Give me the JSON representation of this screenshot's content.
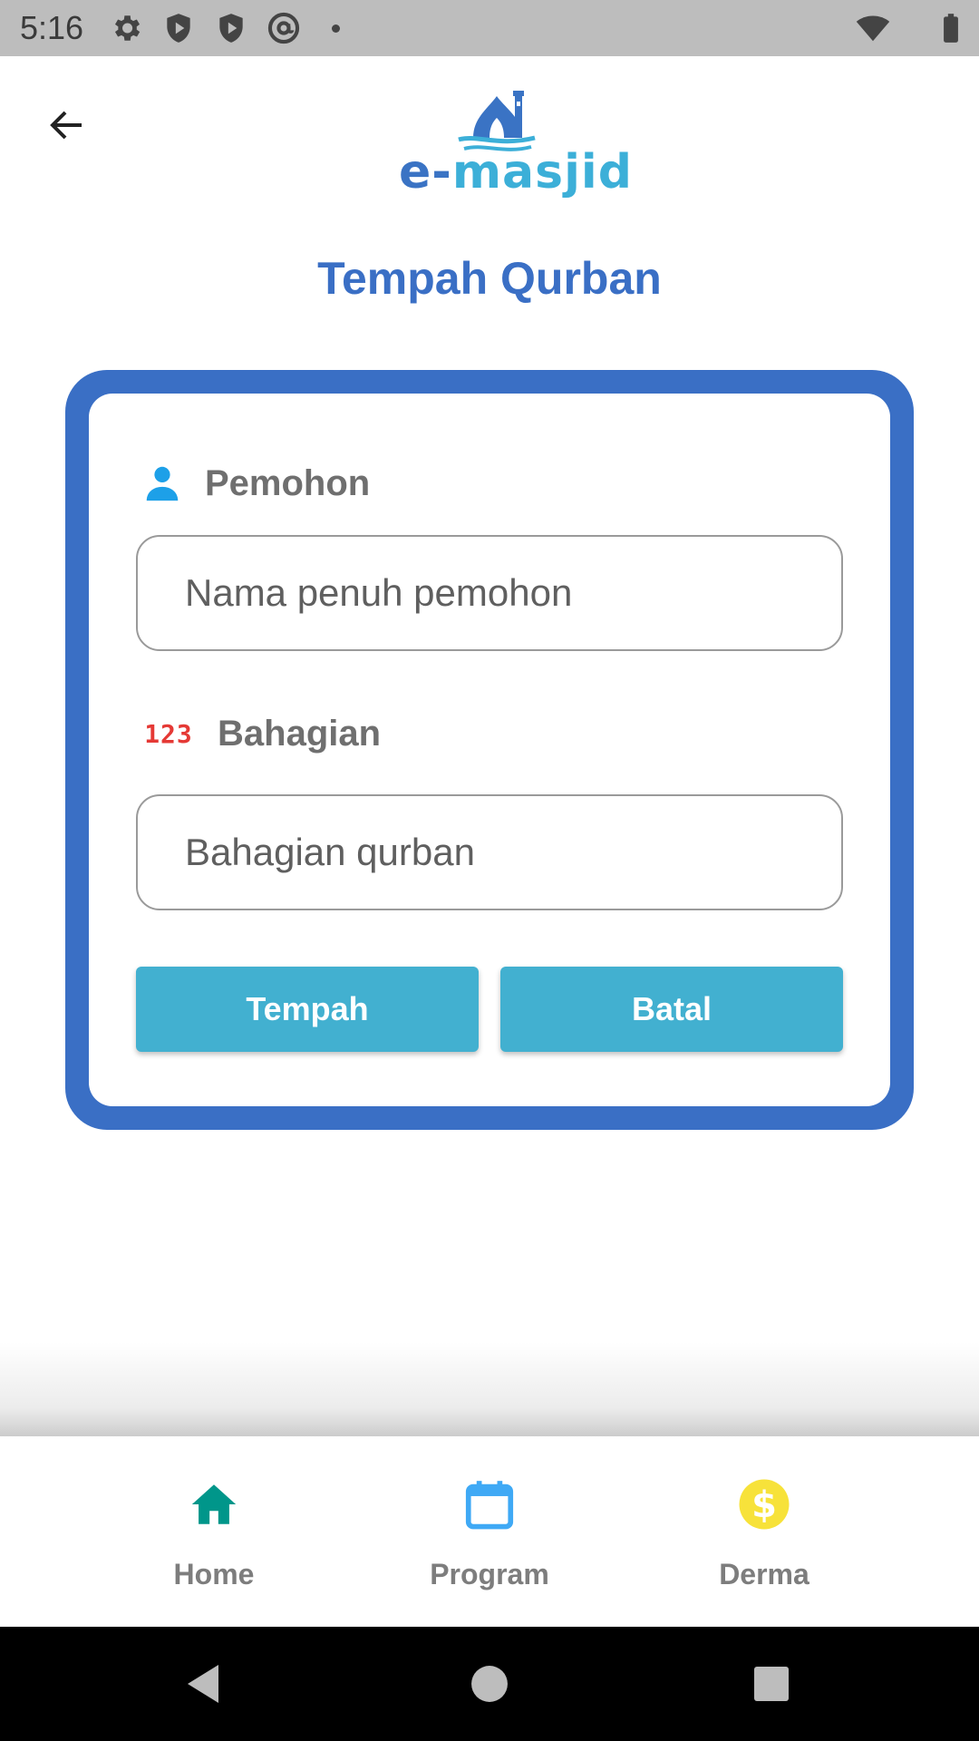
{
  "status_bar": {
    "time": "5:16"
  },
  "logo": {
    "text_prefix": "e-",
    "text_main": "masjid"
  },
  "page": {
    "title": "Tempah Qurban"
  },
  "form": {
    "applicant_label": "Pemohon",
    "applicant_icon": "person-icon",
    "applicant_placeholder": "Nama penuh pemohon",
    "portion_label": "Bahagian",
    "portion_icon": "123-numbers-icon",
    "portion_badge": "123",
    "portion_placeholder": "Bahagian qurban",
    "submit_label": "Tempah",
    "cancel_label": "Batal"
  },
  "bottom_nav": {
    "items": [
      {
        "label": "Home",
        "icon": "home-icon",
        "color": "#00968a"
      },
      {
        "label": "Program",
        "icon": "calendar-icon",
        "color": "#3fa9f5"
      },
      {
        "label": "Derma",
        "icon": "dollar-icon",
        "color": "#f7e23a"
      }
    ]
  },
  "colors": {
    "primary": "#3a6fc5",
    "button": "#42b0d0",
    "person_icon": "#1da0e8",
    "number_icon": "#e53935"
  }
}
